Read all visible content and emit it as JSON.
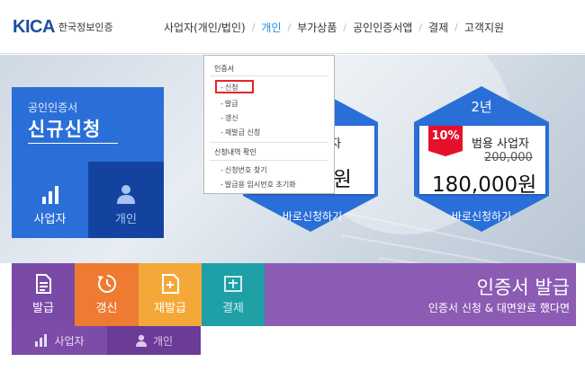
{
  "header": {
    "logo_mark": "KICA",
    "logo_text": "한국정보인증",
    "nav": [
      {
        "label": "사업자(개인/법인)",
        "active": false
      },
      {
        "label": "개인",
        "active": true
      },
      {
        "label": "부가상품",
        "active": false
      },
      {
        "label": "공인인증서앱",
        "active": false
      },
      {
        "label": "결제",
        "active": false
      },
      {
        "label": "고객지원",
        "active": false
      }
    ],
    "nav_separator": "/"
  },
  "dropdown": {
    "group1": "인증서",
    "items1": [
      "신청",
      "발급",
      "갱신",
      "재발급 신청"
    ],
    "group2": "신청내역 확인",
    "items2": [
      "신청번호 찾기",
      "발급용 임시번호 초기화"
    ],
    "dash": "-",
    "selected": "신청"
  },
  "apply": {
    "subtitle": "공인인증서",
    "title": "신규신청",
    "business_label": "사업자",
    "individual_label": "개인"
  },
  "products": [
    {
      "year": "",
      "name": "자",
      "price": "0원",
      "cta": "바로신청하기"
    },
    {
      "year": "2년",
      "badge": "10%",
      "name": "범용 사업자",
      "old_price": "200,000",
      "price": "180,000원",
      "cta": "바로신청하기"
    }
  ],
  "services": {
    "issue_label": "발급",
    "renew_label": "갱신",
    "reissue_label": "재발급",
    "pay_label": "결제",
    "issue_title": "인증서 발급",
    "issue_subtitle": "인증서 신청 & 대면완료 했다면",
    "sub_business": "사업자",
    "sub_individual": "개인"
  },
  "colors": {
    "primary_blue": "#2a6fd8",
    "dark_blue": "#14439f",
    "hex_blue": "#2a6fd8",
    "purple": "#8c5bb4",
    "orange": "#ef7a31",
    "amber": "#f5a83a",
    "teal": "#1f9fa6",
    "badge_red": "#e5112a",
    "highlight_red": "#e2262b"
  },
  "icons": [
    "document-icon",
    "renew-clock-icon",
    "add-document-icon",
    "payment-icon",
    "bar-chart-icon",
    "person-icon"
  ]
}
